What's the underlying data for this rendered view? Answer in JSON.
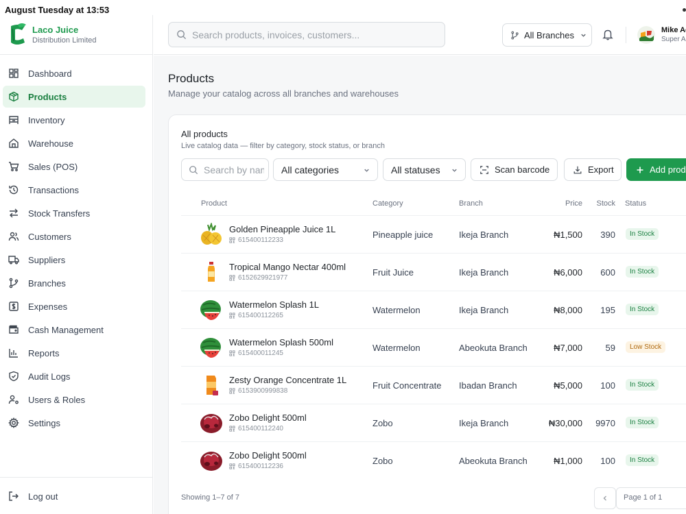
{
  "status_bar": {
    "time": "August Tuesday at 13:53"
  },
  "brand": {
    "name": "Laco Juice",
    "subtitle": "Distribution Limited",
    "accent": "#1e9a4e"
  },
  "sidebar": {
    "items": [
      {
        "label": "Dashboard",
        "icon": "dashboard-icon",
        "active": false
      },
      {
        "label": "Products",
        "icon": "package-icon",
        "active": true
      },
      {
        "label": "Inventory",
        "icon": "inventory-icon",
        "active": false
      },
      {
        "label": "Warehouse",
        "icon": "warehouse-icon",
        "active": false
      },
      {
        "label": "Sales (POS)",
        "icon": "cart-icon",
        "active": false
      },
      {
        "label": "Transactions",
        "icon": "history-icon",
        "active": false
      },
      {
        "label": "Stock Transfers",
        "icon": "transfer-icon",
        "active": false
      },
      {
        "label": "Customers",
        "icon": "users-icon",
        "active": false
      },
      {
        "label": "Suppliers",
        "icon": "truck-icon",
        "active": false
      },
      {
        "label": "Branches",
        "icon": "branch-icon",
        "active": false
      },
      {
        "label": "Expenses",
        "icon": "receipt-icon",
        "active": false
      },
      {
        "label": "Cash Management",
        "icon": "wallet-icon",
        "active": false
      },
      {
        "label": "Reports",
        "icon": "bar-chart-icon",
        "active": false
      },
      {
        "label": "Audit Logs",
        "icon": "shield-icon",
        "active": false
      },
      {
        "label": "Users & Roles",
        "icon": "user-cog-icon",
        "active": false
      },
      {
        "label": "Settings",
        "icon": "gear-icon",
        "active": false
      }
    ],
    "logout_label": "Log out"
  },
  "topbar": {
    "search_placeholder": "Search products, invoices, customers...",
    "branch_selector": "All Branches",
    "user_name": "Mike Ac",
    "user_role": "Super Ad"
  },
  "page": {
    "title": "Products",
    "subtitle": "Manage your catalog across all branches and warehouses"
  },
  "card": {
    "title": "All products",
    "subtitle": "Live catalog data — filter by category, stock status, or branch"
  },
  "filters": {
    "search_placeholder": "Search by name",
    "category": "All categories",
    "status": "All statuses",
    "scan_label": "Scan barcode",
    "export_label": "Export",
    "add_label": "Add produ"
  },
  "table": {
    "headers": {
      "product": "Product",
      "category": "Category",
      "branch": "Branch",
      "price": "Price",
      "stock": "Stock",
      "status": "Status"
    },
    "rows": [
      {
        "name": "Golden Pineapple Juice 1L",
        "sku": "615400112233",
        "category": "Pineapple juice",
        "branch": "Ikeja Branch",
        "price": "₦1,500",
        "stock": "390",
        "status": "In Stock",
        "thumb": "pineapple"
      },
      {
        "name": "Tropical Mango Nectar 400ml",
        "sku": "6152629921977",
        "category": "Fruit Juice",
        "branch": "Ikeja Branch",
        "price": "₦6,000",
        "stock": "600",
        "status": "In Stock",
        "thumb": "bottle"
      },
      {
        "name": "Watermelon Splash 1L",
        "sku": "615400112265",
        "category": "Watermelon",
        "branch": "Ikeja Branch",
        "price": "₦8,000",
        "stock": "195",
        "status": "In Stock",
        "thumb": "watermelon"
      },
      {
        "name": "Watermelon Splash 500ml",
        "sku": "615400011245",
        "category": "Watermelon",
        "branch": "Abeokuta Branch",
        "price": "₦7,000",
        "stock": "59",
        "status": "Low Stock",
        "thumb": "watermelon"
      },
      {
        "name": "Zesty Orange Concentrate 1L",
        "sku": "6153900999838",
        "category": "Fruit Concentrate",
        "branch": "Ibadan Branch",
        "price": "₦5,000",
        "stock": "100",
        "status": "In Stock",
        "thumb": "carton"
      },
      {
        "name": "Zobo Delight 500ml",
        "sku": "615400112240",
        "category": "Zobo",
        "branch": "Ikeja Branch",
        "price": "₦30,000",
        "stock": "9970",
        "status": "In Stock",
        "thumb": "zobo"
      },
      {
        "name": "Zobo Delight 500ml",
        "sku": "615400112236",
        "category": "Zobo",
        "branch": "Abeokuta Branch",
        "price": "₦1,000",
        "stock": "100",
        "status": "In Stock",
        "thumb": "zobo"
      }
    ]
  },
  "footer": {
    "showing": "Showing 1–7 of 7",
    "page_info": "Page 1 of 1"
  },
  "colors": {
    "in_stock_bg": "#e8f6ec",
    "in_stock_text": "#1a7f40",
    "low_stock_bg": "#fdf3e2",
    "low_stock_text": "#b06a10"
  }
}
